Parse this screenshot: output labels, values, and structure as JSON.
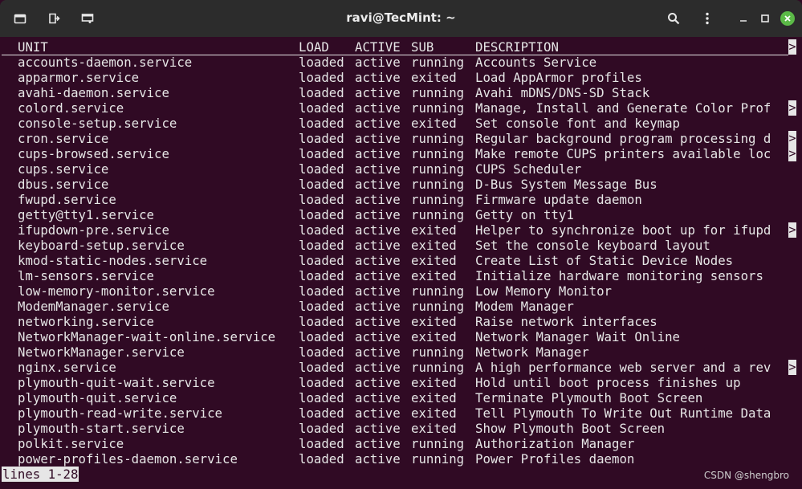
{
  "window": {
    "title": "ravi@TecMint: ~"
  },
  "titlebar": {
    "buttons": [
      {
        "name": "new-tab-icon"
      },
      {
        "name": "detach-tab-icon"
      },
      {
        "name": "split-view-icon"
      }
    ],
    "right": [
      "search-icon",
      "menu-icon",
      "minimize-icon",
      "maximize-icon",
      "close-icon"
    ]
  },
  "terminal": {
    "headers": {
      "unit": "UNIT",
      "load": "LOAD",
      "active": "ACTIVE",
      "sub": "SUB",
      "description": "DESCRIPTION"
    },
    "header_truncated": true,
    "rows": [
      {
        "unit": "accounts-daemon.service",
        "load": "loaded",
        "active": "active",
        "sub": "running",
        "description": "Accounts Service",
        "truncated": false
      },
      {
        "unit": "apparmor.service",
        "load": "loaded",
        "active": "active",
        "sub": "exited",
        "description": "Load AppArmor profiles",
        "truncated": false
      },
      {
        "unit": "avahi-daemon.service",
        "load": "loaded",
        "active": "active",
        "sub": "running",
        "description": "Avahi mDNS/DNS-SD Stack",
        "truncated": false
      },
      {
        "unit": "colord.service",
        "load": "loaded",
        "active": "active",
        "sub": "running",
        "description": "Manage, Install and Generate Color Prof",
        "truncated": true
      },
      {
        "unit": "console-setup.service",
        "load": "loaded",
        "active": "active",
        "sub": "exited",
        "description": "Set console font and keymap",
        "truncated": false
      },
      {
        "unit": "cron.service",
        "load": "loaded",
        "active": "active",
        "sub": "running",
        "description": "Regular background program processing d",
        "truncated": true
      },
      {
        "unit": "cups-browsed.service",
        "load": "loaded",
        "active": "active",
        "sub": "running",
        "description": "Make remote CUPS printers available loc",
        "truncated": true
      },
      {
        "unit": "cups.service",
        "load": "loaded",
        "active": "active",
        "sub": "running",
        "description": "CUPS Scheduler",
        "truncated": false
      },
      {
        "unit": "dbus.service",
        "load": "loaded",
        "active": "active",
        "sub": "running",
        "description": "D-Bus System Message Bus",
        "truncated": false
      },
      {
        "unit": "fwupd.service",
        "load": "loaded",
        "active": "active",
        "sub": "running",
        "description": "Firmware update daemon",
        "truncated": false
      },
      {
        "unit": "getty@tty1.service",
        "load": "loaded",
        "active": "active",
        "sub": "running",
        "description": "Getty on tty1",
        "truncated": false
      },
      {
        "unit": "ifupdown-pre.service",
        "load": "loaded",
        "active": "active",
        "sub": "exited",
        "description": "Helper to synchronize boot up for ifupd",
        "truncated": true
      },
      {
        "unit": "keyboard-setup.service",
        "load": "loaded",
        "active": "active",
        "sub": "exited",
        "description": "Set the console keyboard layout",
        "truncated": false
      },
      {
        "unit": "kmod-static-nodes.service",
        "load": "loaded",
        "active": "active",
        "sub": "exited",
        "description": "Create List of Static Device Nodes",
        "truncated": false
      },
      {
        "unit": "lm-sensors.service",
        "load": "loaded",
        "active": "active",
        "sub": "exited",
        "description": "Initialize hardware monitoring sensors",
        "truncated": false
      },
      {
        "unit": "low-memory-monitor.service",
        "load": "loaded",
        "active": "active",
        "sub": "running",
        "description": "Low Memory Monitor",
        "truncated": false
      },
      {
        "unit": "ModemManager.service",
        "load": "loaded",
        "active": "active",
        "sub": "running",
        "description": "Modem Manager",
        "truncated": false
      },
      {
        "unit": "networking.service",
        "load": "loaded",
        "active": "active",
        "sub": "exited",
        "description": "Raise network interfaces",
        "truncated": false
      },
      {
        "unit": "NetworkManager-wait-online.service",
        "load": "loaded",
        "active": "active",
        "sub": "exited",
        "description": "Network Manager Wait Online",
        "truncated": false
      },
      {
        "unit": "NetworkManager.service",
        "load": "loaded",
        "active": "active",
        "sub": "running",
        "description": "Network Manager",
        "truncated": false
      },
      {
        "unit": "nginx.service",
        "load": "loaded",
        "active": "active",
        "sub": "running",
        "description": "A high performance web server and a rev",
        "truncated": true
      },
      {
        "unit": "plymouth-quit-wait.service",
        "load": "loaded",
        "active": "active",
        "sub": "exited",
        "description": "Hold until boot process finishes up",
        "truncated": false
      },
      {
        "unit": "plymouth-quit.service",
        "load": "loaded",
        "active": "active",
        "sub": "exited",
        "description": "Terminate Plymouth Boot Screen",
        "truncated": false
      },
      {
        "unit": "plymouth-read-write.service",
        "load": "loaded",
        "active": "active",
        "sub": "exited",
        "description": "Tell Plymouth To Write Out Runtime Data",
        "truncated": false
      },
      {
        "unit": "plymouth-start.service",
        "load": "loaded",
        "active": "active",
        "sub": "exited",
        "description": "Show Plymouth Boot Screen",
        "truncated": false
      },
      {
        "unit": "polkit.service",
        "load": "loaded",
        "active": "active",
        "sub": "running",
        "description": "Authorization Manager",
        "truncated": false
      },
      {
        "unit": "power-profiles-daemon.service",
        "load": "loaded",
        "active": "active",
        "sub": "running",
        "description": "Power Profiles daemon",
        "truncated": false
      }
    ],
    "pager_status": "lines 1-28",
    "truncation_marker": ">"
  },
  "watermark": "CSDN @shengbro",
  "colors": {
    "terminal_bg": "#300a24",
    "text": "#e6e6e6",
    "titlebar_bg": "#2c2c2c",
    "close_button": "#5bba47"
  }
}
